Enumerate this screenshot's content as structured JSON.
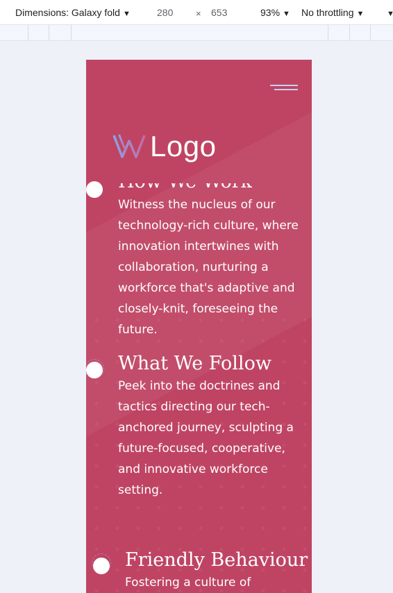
{
  "devtools": {
    "dimensions_label": "Dimensions: Galaxy fold",
    "width": "280",
    "times": "×",
    "height": "653",
    "zoom": "93%",
    "throttle": "No throttling"
  },
  "site": {
    "logo_text": "Logo",
    "colors": {
      "background": "#bf4463",
      "logo_mark_start": "#8aa3e6",
      "logo_mark_end": "#c76aa5"
    },
    "items": [
      {
        "title": "How We Work",
        "text": "Witness the nucleus of our technology-rich culture, where innovation intertwines with collaboration, nurturing a workforce that's adaptive and closely-knit, foreseeing the future."
      },
      {
        "title": "What We Follow",
        "text": "Peek into the doctrines and tactics directing our tech-anchored journey, sculpting a future-focused, cooperative, and innovative workforce setting."
      },
      {
        "title": "Friendly Behaviour",
        "text": "Fostering a culture of"
      }
    ]
  }
}
